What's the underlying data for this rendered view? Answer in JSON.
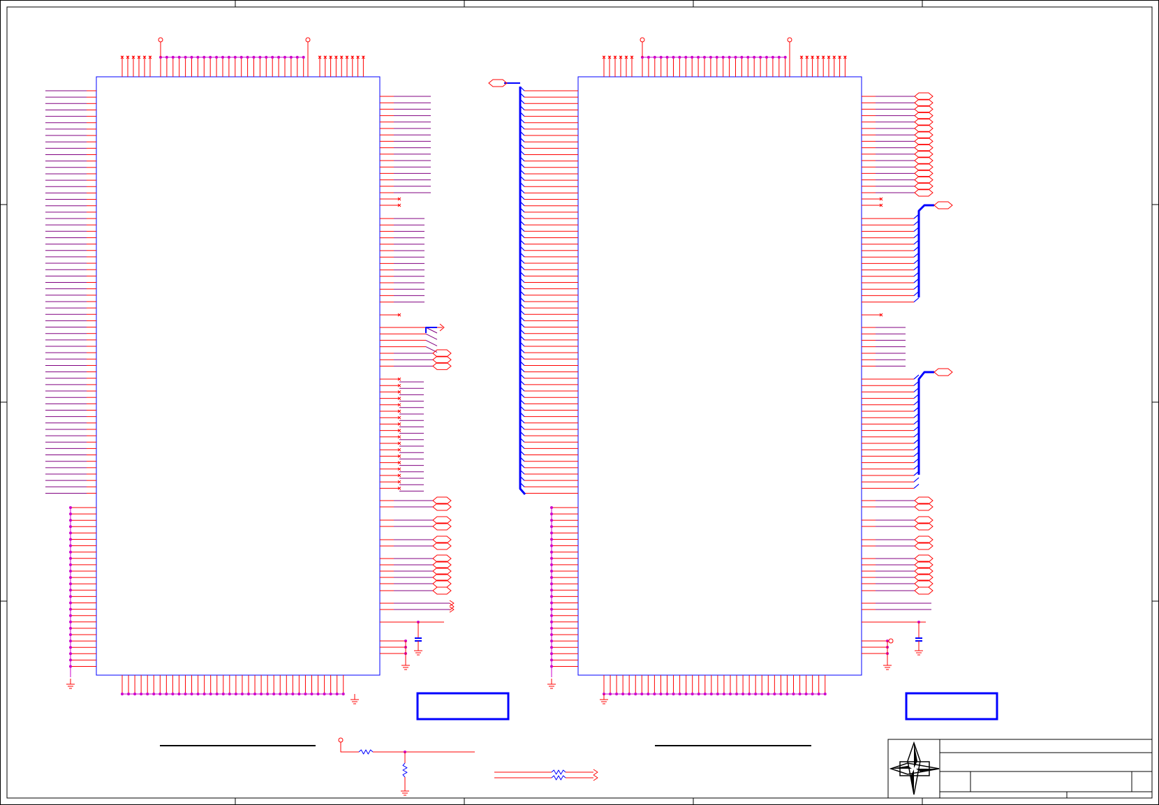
{
  "sheet": {
    "title_block": {
      "title": "",
      "subtitle": "",
      "doc_number": "",
      "rev": "",
      "sheet": ""
    },
    "section_labels": {
      "left": "",
      "right": ""
    },
    "chip_labels": {
      "left": "",
      "right": ""
    }
  },
  "colors": {
    "background": "#ffffff",
    "border": "#000000",
    "ic_outline": "#0000ff",
    "pin_wire": "#ff0000",
    "signal_wire": "#800080",
    "junction": "#cc00cc",
    "bus": "#0000ff",
    "capacitor": "#0000ff",
    "port": "#ff0000"
  },
  "icons": {
    "logo": "compass-star-logo",
    "ground": "ground-symbol",
    "power": "power-pin-symbol",
    "port": "offpage-port-symbol",
    "resistor": "resistor-symbol",
    "capacitor": "capacitor-symbol"
  }
}
